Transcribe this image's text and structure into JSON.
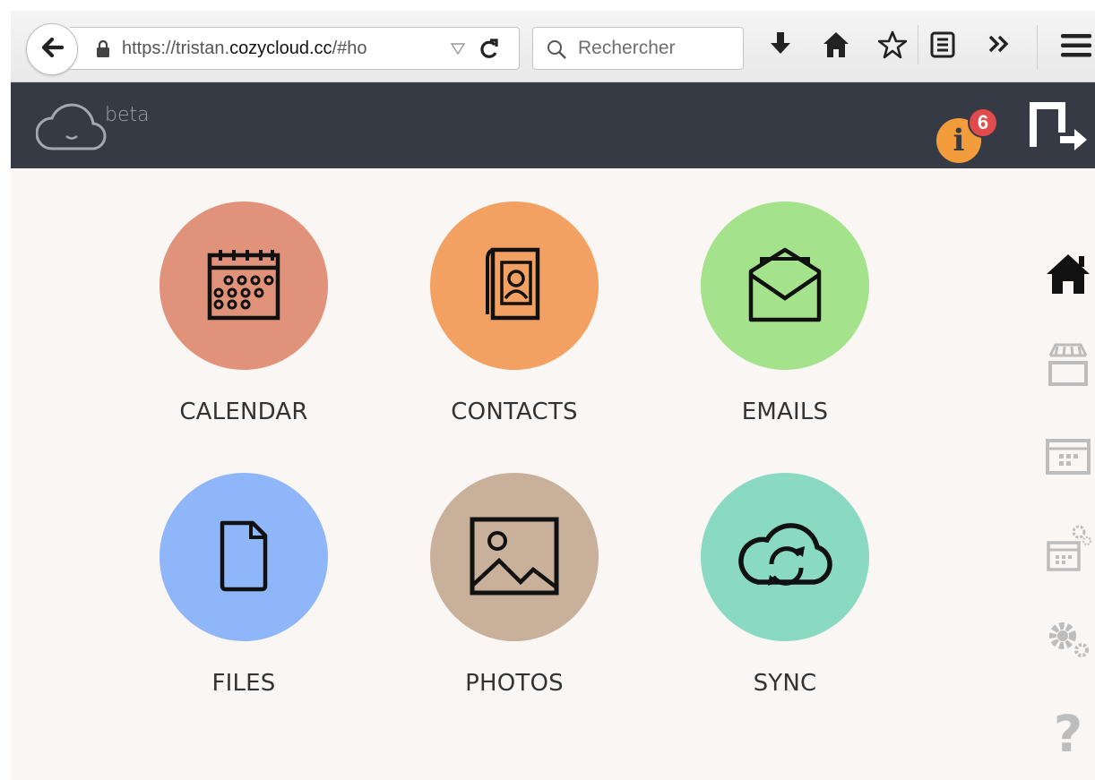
{
  "browser": {
    "url_prefix": "https://tristan.",
    "url_domain": "cozycloud.cc",
    "url_suffix": "/#ho",
    "search_placeholder": "Rechercher"
  },
  "header": {
    "logo_beta": "beta",
    "notifications_count": "6",
    "info_glyph": "i"
  },
  "apps": [
    {
      "label": "CALENDAR",
      "icon": "calendar-icon",
      "color": "#e0937a"
    },
    {
      "label": "CONTACTS",
      "icon": "contacts-icon",
      "color": "#f3a162"
    },
    {
      "label": "EMAILS",
      "icon": "emails-icon",
      "color": "#a4e38b"
    },
    {
      "label": "FILES",
      "icon": "files-icon",
      "color": "#8fb6f9"
    },
    {
      "label": "PHOTOS",
      "icon": "photos-icon",
      "color": "#c9b09a"
    },
    {
      "label": "SYNC",
      "icon": "sync-icon",
      "color": "#8ad9c3"
    }
  ],
  "right_nav": [
    {
      "icon": "home-icon",
      "active": true
    },
    {
      "icon": "store-icon"
    },
    {
      "icon": "calendar-grid-icon"
    },
    {
      "icon": "app-settings-icon"
    },
    {
      "icon": "gears-icon"
    },
    {
      "icon": "help-icon",
      "glyph": "?"
    }
  ],
  "colors": {
    "header_bg": "#363a45",
    "main_bg": "#faf6f3",
    "accent": "#f39c3c",
    "badge": "#e24b4b"
  }
}
